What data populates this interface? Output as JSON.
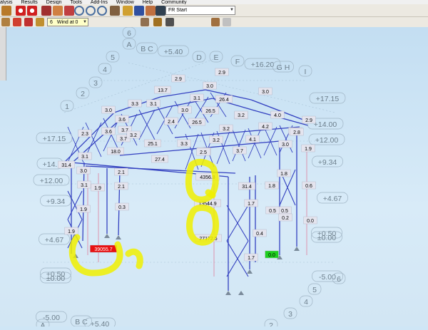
{
  "menubar": {
    "items": [
      "alysis",
      "Results",
      "Design",
      "Tools",
      "Add-Ins",
      "Window",
      "Help",
      "Community"
    ]
  },
  "toolbar": {
    "view_combo": "FR Start"
  },
  "loadcase": {
    "number": "6",
    "name": "Wind at 0"
  },
  "colors": {
    "member": "#3340c0",
    "support": "#e02020",
    "highlight": "#f0f000",
    "label_fill": "#e4e4ee"
  },
  "viewport": {
    "grid_labels": [
      "6",
      "A",
      "B C",
      "5",
      "+5.40",
      "D",
      "E",
      "4",
      "F",
      "+16.20",
      "G H",
      "I",
      "3",
      "2",
      "+17.15",
      "1",
      "+14.00",
      "+12.00",
      "+17.15",
      "+9.34",
      "+14.",
      "+12.00",
      "+4.67",
      "+9.34",
      "+4.67",
      "+0.50",
      "±0.00",
      "+0.50",
      "±0.00",
      "-5.00",
      "6",
      "5",
      "4",
      "3",
      "-5.00",
      "B C",
      "+5.40",
      "A",
      "2"
    ],
    "values": [
      "2.9",
      "3.0",
      "2.9",
      "13.7",
      "3.1",
      "26.4",
      "3.0",
      "3.3",
      "3.1",
      "3.0",
      "26.5",
      "3.1",
      "3.0",
      "3.6",
      "2.4",
      "26.5",
      "3.2",
      "4.0",
      "3.6",
      "3.7",
      "3.2",
      "4.2",
      "3.7",
      "3.2",
      "25.1",
      "3.3",
      "2.5",
      "4.1",
      "3.0",
      "3.8",
      "18.0",
      "27.4",
      "3.2",
      "3.7",
      "2.9",
      "2.8",
      "3.1",
      "31.4",
      "1.9",
      "3.1",
      "3.0",
      "2.1",
      "4356.8",
      "2.5",
      "1.8",
      "2.1",
      "31.4",
      "1.8",
      "0.6",
      "1.9",
      "0.3",
      "13544.9",
      "1.7",
      "0.5",
      "0.5",
      "1.9",
      "27172.5",
      "0.4",
      "0.2",
      "0.0",
      "39055.7",
      "1.7",
      "0.0",
      "1.9",
      "2.3"
    ]
  }
}
